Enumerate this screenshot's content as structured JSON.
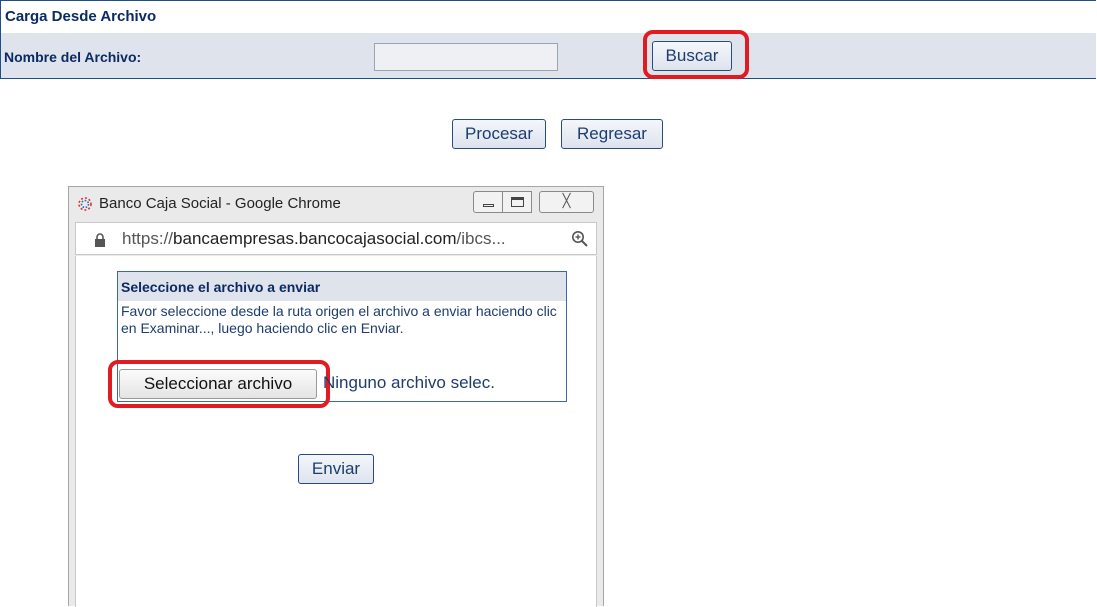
{
  "form": {
    "title": "Carga Desde Archivo",
    "file_label": "Nombre del Archivo:",
    "file_value": "",
    "buscar_label": "Buscar",
    "procesar_label": "Procesar",
    "regresar_label": "Regresar"
  },
  "popup": {
    "window_title": "Banco Caja Social - Google Chrome",
    "window_controls": {
      "minimize": "minimize-icon",
      "maximize": "maximize-icon",
      "close": "╳"
    },
    "address": {
      "scheme": "https://",
      "host": "bancaempresas.bancocajasocial.com",
      "path": "/ibcs..."
    },
    "panel_title": "Seleccione el archivo a enviar",
    "panel_text": "Favor seleccione desde la ruta origen el archivo a enviar haciendo clic en Examinar..., luego haciendo clic en Enviar.",
    "select_file_label": "Seleccionar archivo",
    "no_file_text": "Ninguno archivo selec.",
    "enviar_label": "Enviar"
  },
  "colors": {
    "title_text": "#0b2a63",
    "row_background": "#dfe3ec",
    "highlight": "#e11b22",
    "button_border": "#2a4c7c"
  }
}
